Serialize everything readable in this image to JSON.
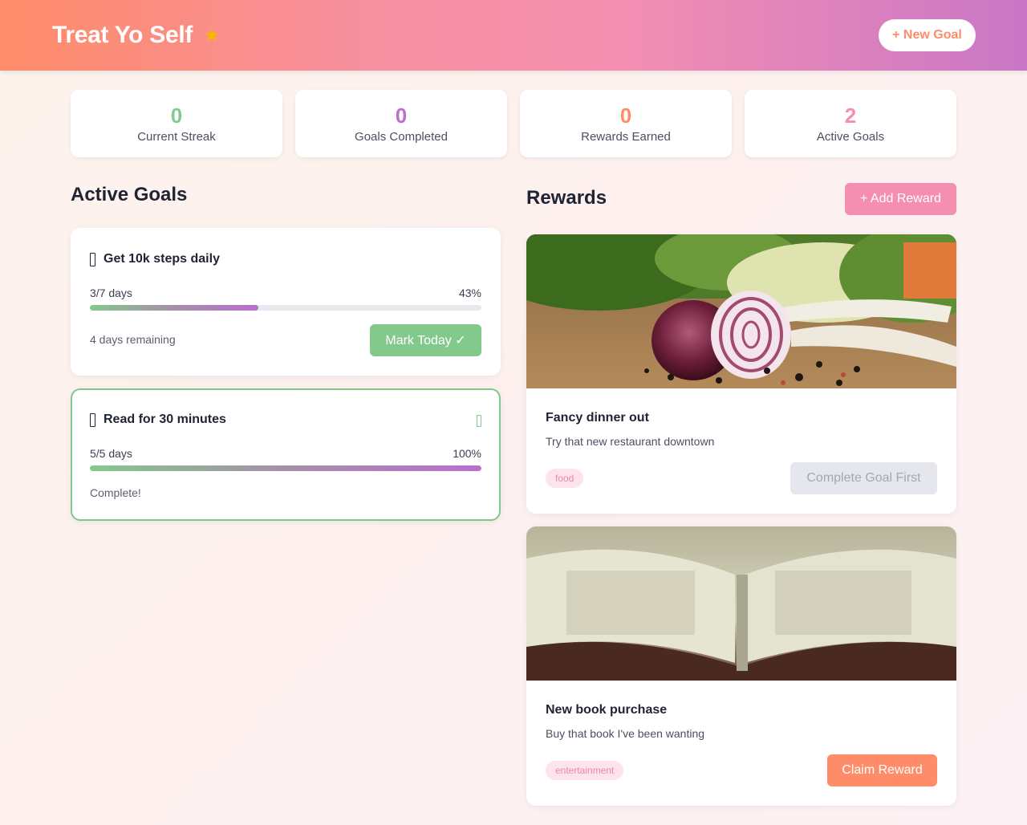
{
  "app": {
    "title": "Treat Yo Self",
    "new_goal_label": "+ New Goal",
    "colors": {
      "accent_orange": "#ff8c69",
      "accent_pink": "#f48fb1",
      "accent_purple": "#b96fd0",
      "accent_green": "#84c98c",
      "star": "#f5b800"
    }
  },
  "stats": [
    {
      "value": "0",
      "label": "Current Streak",
      "color": "#84c98c"
    },
    {
      "value": "0",
      "label": "Goals Completed",
      "color": "#b96fd0"
    },
    {
      "value": "0",
      "label": "Rewards Earned",
      "color": "#ff8c69"
    },
    {
      "value": "2",
      "label": "Active Goals",
      "color": "#f48fb1"
    }
  ],
  "goals_section": {
    "title": "Active Goals",
    "goals": [
      {
        "title": "Get 10k steps daily",
        "progress_text": "3/7 days",
        "percent_text": "43%",
        "progress_fraction": 0.43,
        "footer_text": "4 days remaining",
        "action_label": "Mark Today ✓"
      },
      {
        "title": "Read for 30 minutes",
        "progress_text": "5/5 days",
        "percent_text": "100%",
        "progress_fraction": 1.0,
        "footer_text": "Complete!"
      }
    ]
  },
  "rewards_section": {
    "title": "Rewards",
    "add_label": "+ Add Reward",
    "rewards": [
      {
        "title": "Fancy dinner out",
        "description": "Try that new restaurant downtown",
        "tag": "food",
        "action_label": "Complete Goal First",
        "image": "onion-vegetables-photo"
      },
      {
        "title": "New book purchase",
        "description": "Buy that book I've been wanting",
        "tag": "entertainment",
        "action_label": "Claim Reward",
        "image": "open-book-photo"
      }
    ]
  }
}
